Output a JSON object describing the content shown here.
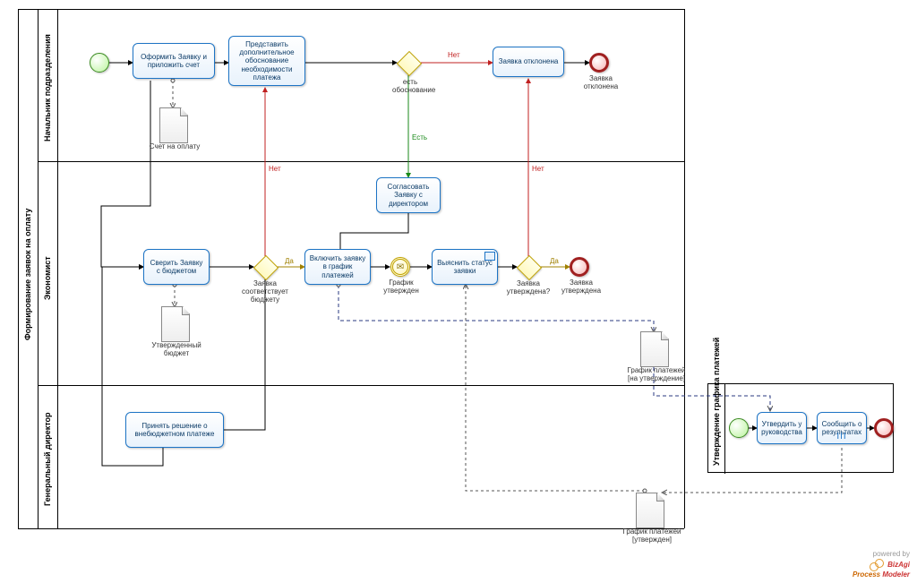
{
  "pool": {
    "title": "Формирование заявок на оплату",
    "lanes": [
      "Начальник подразделения",
      "Экономист",
      "Генеральный директор"
    ]
  },
  "subprocess": {
    "title": "Утверждение графика платежей"
  },
  "tasks": {
    "t1": "Оформить  Заявку и приложить счет",
    "t2": "Представить дополнительное обоснование необходимости платежа",
    "t3": "Заявка отклонена",
    "t4": "Согласовать Заявку с директором",
    "t5": "Сверить Заявку с бюджетом",
    "t6": "Включить заявку в график платежей",
    "t7": "Выяснить статус заявки",
    "t8": "Принять решение о внебюджетном платеже",
    "sp1": "Утвердить у руководства",
    "sp2": "Сообщить о результатах"
  },
  "gateway_labels": {
    "g1": "есть обоснование",
    "g2": "Заявка соответствует бюджету",
    "g3": "Заявка утверждена?"
  },
  "flow_labels": {
    "no1": "Нет",
    "no2": "Нет",
    "no3": "Нет",
    "yes1": "Есть",
    "yes2": "Да",
    "yes3": "Да"
  },
  "event_labels": {
    "end1": "Заявка отклонена",
    "msg1": "График утвержден",
    "end2": "Заявка утверждена"
  },
  "data_objects": {
    "d1": "Счет на оплату",
    "d2": "Утвержденный бюджет",
    "d3": "График платежей [на утверждение]",
    "d4": "График платежей [утвержден]"
  },
  "watermark": {
    "line1": "powered by",
    "brand1": "BizAgi",
    "brand2": "Process ",
    "brand3": "Modeler"
  }
}
